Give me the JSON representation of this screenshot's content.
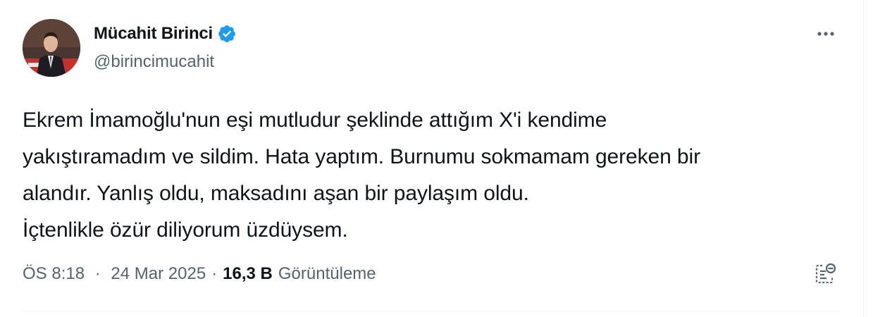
{
  "author": {
    "display_name": "Mücahit Birinci",
    "handle": "@birincimucahit",
    "verified": true
  },
  "tweet": {
    "text": "Ekrem İmamoğlu'nun eşi mutludur şeklinde attığım X'i kendime\nyakıştıramadım ve sildim. Hata yaptım. Burnumu sokmamam gereken bir\nalandır. Yanlış oldu, maksadını aşan bir paylaşım oldu.\nİçtenlikle özür diliyorum üzdüysem."
  },
  "meta": {
    "time": "ÖS 8:18",
    "separator": "·",
    "date": "24 Mar 2025",
    "views_count": "16,3 B",
    "views_label": "Görüntüleme"
  },
  "icons": {
    "verified": "verified-badge-icon",
    "more": "more-horizontal-icon",
    "analytics": "post-analytics-icon"
  },
  "colors": {
    "text_primary": "#0f1419",
    "text_secondary": "#536471",
    "verified_blue": "#1d9bf0",
    "divider": "#eff3f4"
  }
}
